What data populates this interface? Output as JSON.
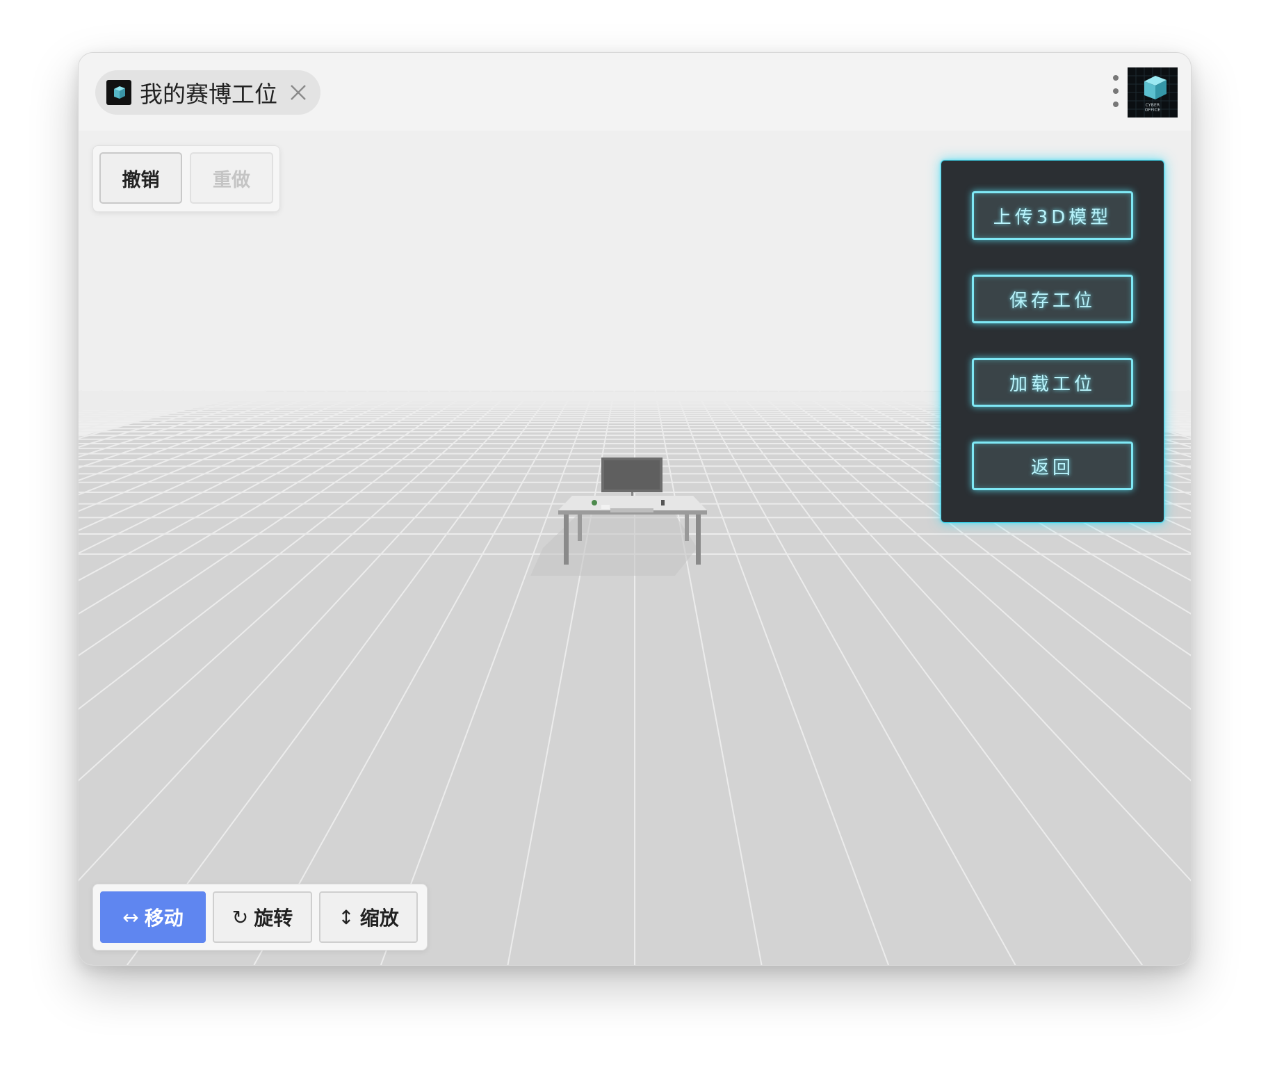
{
  "window": {
    "tab": {
      "title": "我的赛博工位",
      "close_icon": "close-icon",
      "app_icon": "cube-icon"
    },
    "menu_icon": "kebab-menu-icon",
    "logo": {
      "text_line1": "CYBER",
      "text_line2": "OFFICE"
    }
  },
  "history_toolbar": {
    "undo_label": "撤销",
    "redo_label": "重做",
    "redo_enabled": false
  },
  "transform_toolbar": {
    "active_mode": "move",
    "modes": [
      {
        "id": "move",
        "symbol": "↔",
        "label": "移动"
      },
      {
        "id": "rotate",
        "symbol": "↻",
        "label": "旋转"
      },
      {
        "id": "scale",
        "symbol": "↕",
        "label": "缩放"
      }
    ]
  },
  "side_panel": {
    "buttons": [
      {
        "label": "上传3D模型"
      },
      {
        "label": "保存工位"
      },
      {
        "label": "加载工位"
      },
      {
        "label": "返回"
      }
    ],
    "accent_color": "#7fe8f5",
    "background_color": "#2b2f33"
  },
  "colors": {
    "active_mode": "#5f86f0",
    "floor": "#d3d3d3",
    "grid": "#ececec"
  }
}
